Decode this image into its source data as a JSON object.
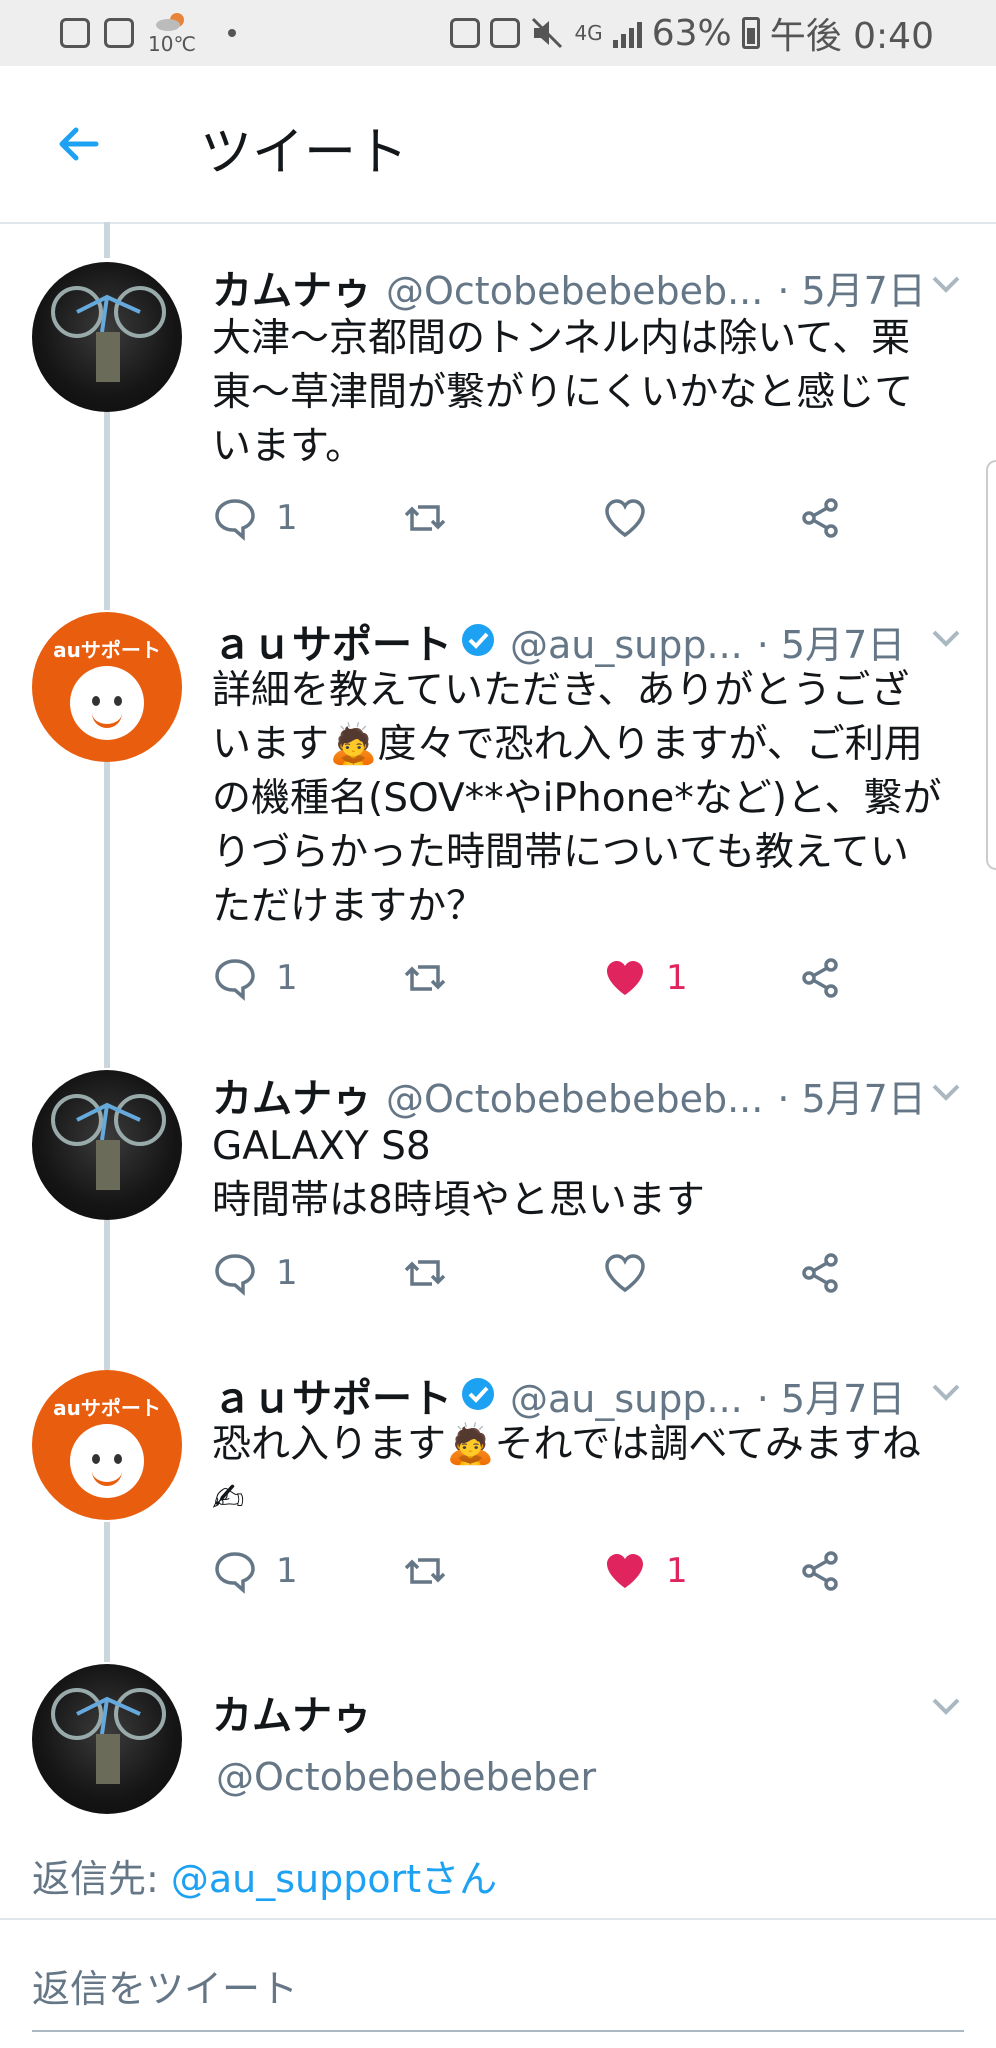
{
  "status_bar": {
    "weather_temp": "10℃",
    "network": "4G",
    "battery": "63%",
    "time": "午後 0:40"
  },
  "header": {
    "title": "ツイート"
  },
  "tweets": [
    {
      "name": "カムナゥ",
      "handle": "@Octobebebebeb...",
      "date": "· 5月7日",
      "text": "大津〜京都間のトンネル内は除いて、栗\n東〜草津間が繋がりにくいかなと感じて\nいます。",
      "reply_count": "1",
      "like_count": "",
      "liked": false
    },
    {
      "name": "ａｕサポート",
      "handle": "@au_supp...",
      "date": "· 5月7日",
      "text": "詳細を教えていただき、ありがとうござ\nいます🙇度々で恐れ入りますが、ご利用\nの機種名(SOV**やiPhone*など)と、繋が\nりづらかった時間帯についても教えてい\nただけますか？",
      "reply_count": "1",
      "like_count": "1",
      "liked": true,
      "avatar_label": "auサポート"
    },
    {
      "name": "カムナゥ",
      "handle": "@Octobebebebeb...",
      "date": "· 5月7日",
      "text": "GALAXY S8\n時間帯は8時頃やと思います",
      "reply_count": "1",
      "like_count": "",
      "liked": false
    },
    {
      "name": "ａｕサポート",
      "handle": "@au_supp...",
      "date": "· 5月7日",
      "text": "恐れ入ります🙇それでは調べてみますね\n✍",
      "reply_count": "1",
      "like_count": "1",
      "liked": true,
      "avatar_label": "auサポート"
    }
  ],
  "reply": {
    "name": "カムナゥ",
    "handle": "@Octobebebebeber",
    "reply_to_prefix": "返信先: ",
    "reply_to_link": "@au_supportさん",
    "placeholder": "返信をツイート"
  },
  "colors": {
    "accent": "#1da1f2",
    "like": "#e0245e",
    "secondary_text": "#657786",
    "brand_orange": "#e85d0e"
  }
}
